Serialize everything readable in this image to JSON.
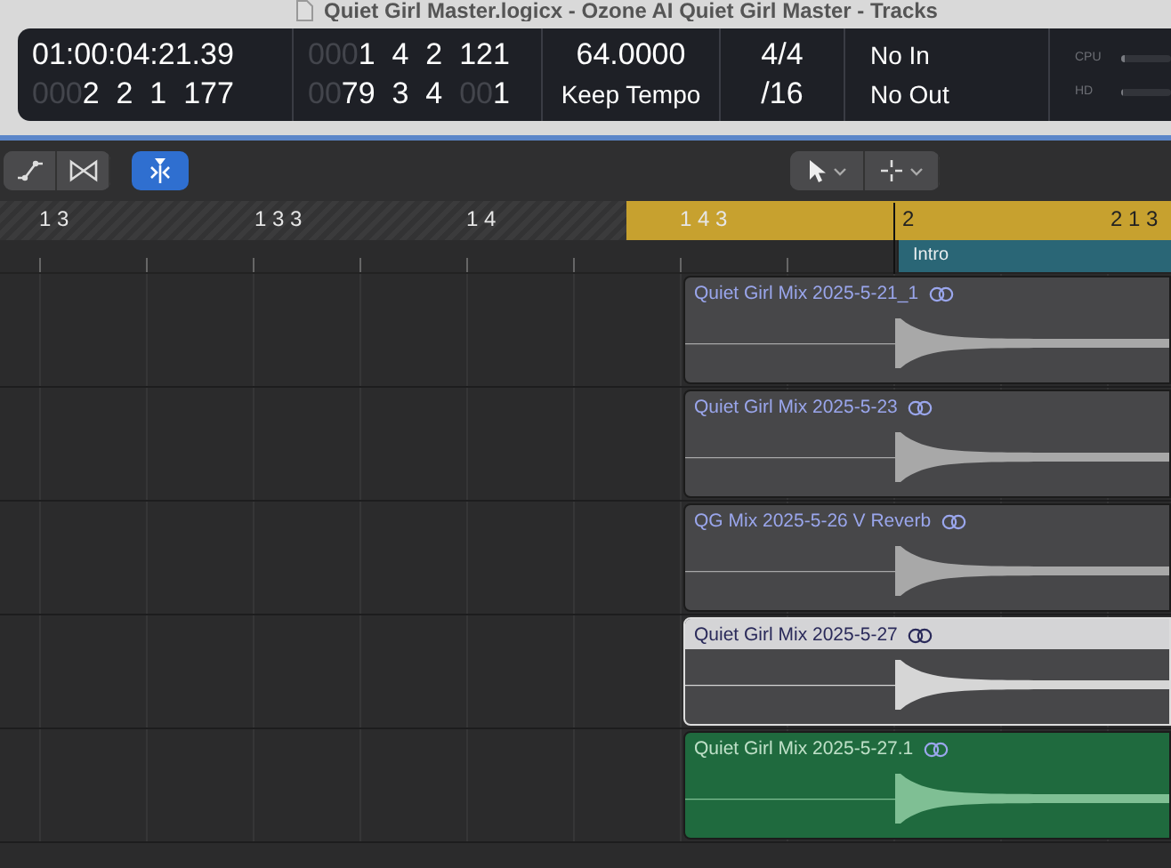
{
  "window": {
    "title": "Quiet Girl Master.logicx - Ozone AI Quiet Girl Master - Tracks"
  },
  "lcd": {
    "columns": [
      {
        "lines": [
          [
            {
              "text": "01:00:04:21.39",
              "dim": false
            }
          ],
          [
            {
              "text": "000",
              "dim": true
            },
            {
              "text": "2  2  1  177",
              "dim": false
            }
          ]
        ]
      },
      {
        "lines": [
          [
            {
              "text": "000",
              "dim": true
            },
            {
              "text": "1  4  2  121",
              "dim": false
            }
          ],
          [
            {
              "text": "00",
              "dim": true
            },
            {
              "text": "79  3  4  ",
              "dim": false
            },
            {
              "text": "00",
              "dim": true
            },
            {
              "text": "1",
              "dim": false
            }
          ]
        ]
      },
      {
        "lines": [
          [
            {
              "text": "64.0000",
              "dim": false
            }
          ],
          [
            {
              "text": "Keep Tempo",
              "dim": false
            }
          ]
        ]
      },
      {
        "lines": [
          [
            {
              "text": "4/4",
              "dim": false
            }
          ],
          [
            {
              "text": "/16",
              "dim": false
            }
          ]
        ]
      },
      {
        "lines": [
          [
            {
              "text": "No In",
              "dim": false
            }
          ],
          [
            {
              "text": "No Out",
              "dim": false
            }
          ]
        ]
      }
    ],
    "meters": [
      {
        "label": "CPU",
        "level": 0.06
      },
      {
        "label": "HD",
        "level": 0.03
      }
    ]
  },
  "toolbar": {
    "left_tools": [
      {
        "kind": "curve",
        "selected": false
      },
      {
        "kind": "bowtie",
        "selected": false
      }
    ],
    "snap": {
      "selected": true
    },
    "right_tools": [
      {
        "kind": "pointer"
      },
      {
        "kind": "crosshair"
      }
    ]
  },
  "ruler": {
    "labels": [
      "1 3",
      "1 3 3",
      "1 4",
      "1 4 3",
      "2",
      "2 1 3"
    ],
    "markers": [
      {
        "label": "Intro"
      }
    ]
  },
  "tracks": [
    {
      "region": {
        "name": "Quiet Girl Mix 2025-5-21_1",
        "selected": false,
        "color": "#474749"
      }
    },
    {
      "region": {
        "name": "Quiet Girl Mix 2025-5-23",
        "selected": false,
        "color": "#474749"
      }
    },
    {
      "region": {
        "name": "QG Mix 2025-5-26 V Reverb",
        "selected": false,
        "color": "#474749"
      }
    },
    {
      "region": {
        "name": "Quiet Girl Mix 2025-5-27",
        "selected": true,
        "color": "#474749"
      }
    },
    {
      "region": {
        "name": "Quiet Girl Mix 2025-5-27.1",
        "selected": false,
        "color": "#1f6a3e"
      }
    }
  ]
}
